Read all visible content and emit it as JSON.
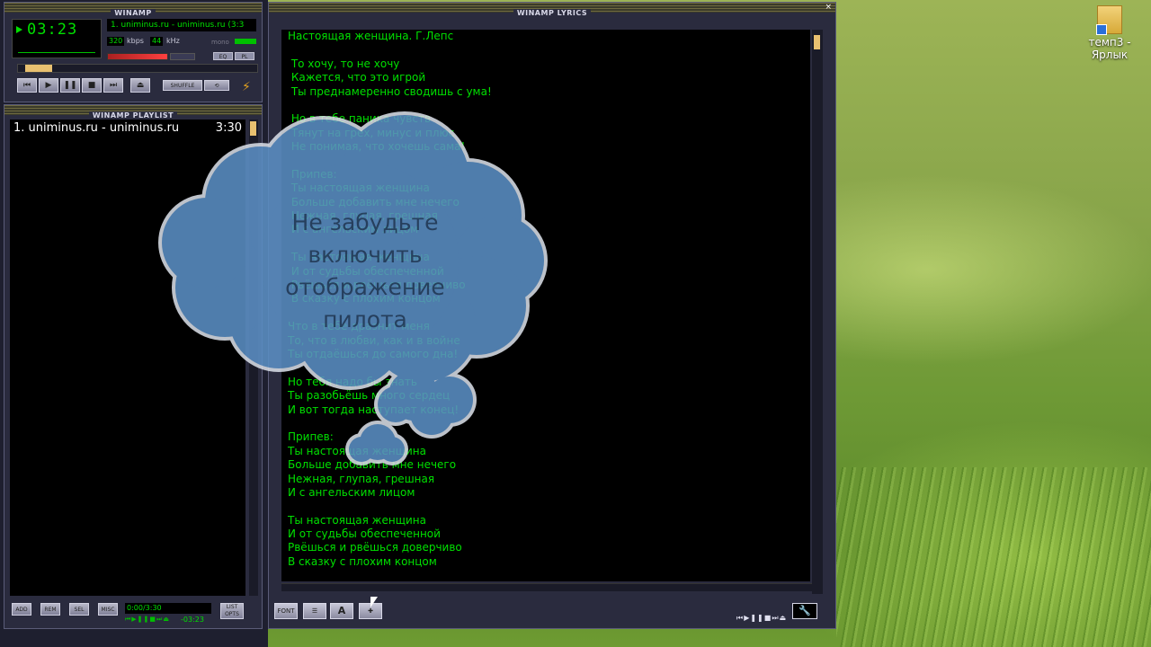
{
  "desktop": {
    "icon_label": "темп3 - Ярлык"
  },
  "winamp": {
    "title": "WINAMP",
    "time": "03:23",
    "song_ticker": "1. uniminus.ru - uniminus.ru (3:3",
    "kbps": "320",
    "kbps_label": "kbps",
    "khz": "44",
    "khz_label": "kHz",
    "mono_label": "mono",
    "eq_label": "EQ",
    "pl_label": "PL",
    "shuffle_label": "SHUFFLE"
  },
  "playlist": {
    "title": "WINAMP PLAYLIST",
    "items": [
      {
        "label": "1. uniminus.ru - uniminus.ru",
        "duration": "3:30"
      }
    ],
    "buttons": [
      "ADD",
      "REM",
      "SEL",
      "MISC"
    ],
    "time_display": "0:00/3:30",
    "elapsed": "-03:23",
    "list_opts": "LIST OPTS"
  },
  "lyrics": {
    "title": "WINAMP LYRICS",
    "lines": [
      "Настоящая женщина. Г.Лепс",
      "",
      " То хочу, то не хочу",
      " Кажется, что это игрой",
      " Ты преднамеренно сводишь с ума!",
      "",
      " Но в тебе паника чувств",
      " Тянут на грех, минус и плюс",
      " Не понимая, что хочешь сама!",
      "",
      " Припев:",
      " Ты настоящая женщина",
      " Больше добавить мне нечего",
      " Нежная, глупая, грешная",
      " И с ангельским лицом",
      "",
      " Ты настоящая женщина",
      " И от судьбы обеспеченной",
      " Рвёшься и рвёшься доверчиво",
      " В сказку с плохим концом",
      "",
      "Что в тебе дразнит меня",
      "То, что в любви, как и в войне",
      "Ты отдаёшься до самого дна!",
      "",
      "Но тебя надо бы знать",
      "Ты разобьёшь много сердец",
      "И вот тогда наступает конец!",
      "",
      "Припев:",
      "Ты настоящая женщина",
      "Больше добавить мне нечего",
      "Нежная, глупая, грешная",
      "И с ангельским лицом",
      "",
      "Ты настоящая женщина",
      "И от судьбы обеспеченной",
      "Рвёшься и рвёшься доверчиво",
      "В сказку с плохим концом"
    ],
    "font_button": "FONT",
    "a_button": "A"
  },
  "overlay": {
    "cloud_text": "Не забудьте включить отображение пилота",
    "cloud_fill": "#5b8fc4",
    "cloud_stroke": "#d8dde6"
  }
}
